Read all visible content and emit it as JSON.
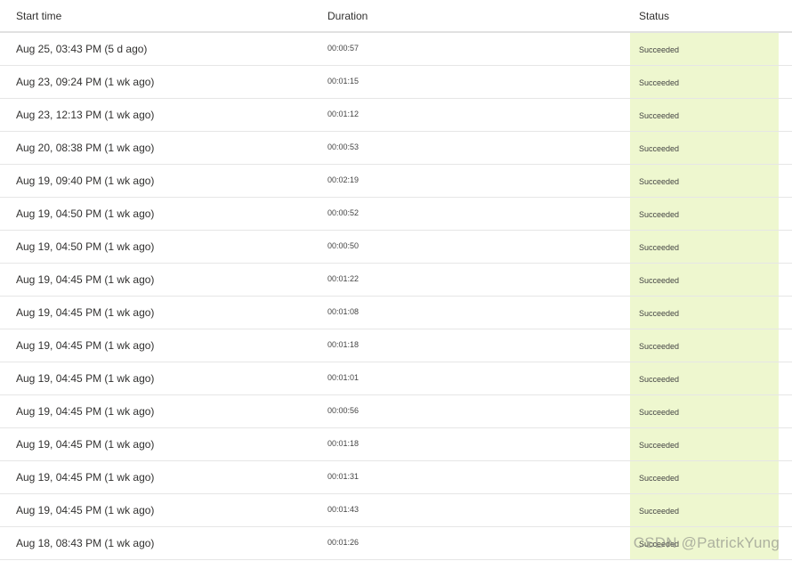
{
  "table": {
    "headers": {
      "start_time": "Start time",
      "duration": "Duration",
      "status": "Status"
    },
    "status_color": "#eef7cf",
    "rows": [
      {
        "start_time": "Aug 25, 03:43 PM (5 d ago)",
        "duration": "00:00:57",
        "status": "Succeeded"
      },
      {
        "start_time": "Aug 23, 09:24 PM (1 wk ago)",
        "duration": "00:01:15",
        "status": "Succeeded"
      },
      {
        "start_time": "Aug 23, 12:13 PM (1 wk ago)",
        "duration": "00:01:12",
        "status": "Succeeded"
      },
      {
        "start_time": "Aug 20, 08:38 PM (1 wk ago)",
        "duration": "00:00:53",
        "status": "Succeeded"
      },
      {
        "start_time": "Aug 19, 09:40 PM (1 wk ago)",
        "duration": "00:02:19",
        "status": "Succeeded"
      },
      {
        "start_time": "Aug 19, 04:50 PM (1 wk ago)",
        "duration": "00:00:52",
        "status": "Succeeded"
      },
      {
        "start_time": "Aug 19, 04:50 PM (1 wk ago)",
        "duration": "00:00:50",
        "status": "Succeeded"
      },
      {
        "start_time": "Aug 19, 04:45 PM (1 wk ago)",
        "duration": "00:01:22",
        "status": "Succeeded"
      },
      {
        "start_time": "Aug 19, 04:45 PM (1 wk ago)",
        "duration": "00:01:08",
        "status": "Succeeded"
      },
      {
        "start_time": "Aug 19, 04:45 PM (1 wk ago)",
        "duration": "00:01:18",
        "status": "Succeeded"
      },
      {
        "start_time": "Aug 19, 04:45 PM (1 wk ago)",
        "duration": "00:01:01",
        "status": "Succeeded"
      },
      {
        "start_time": "Aug 19, 04:45 PM (1 wk ago)",
        "duration": "00:00:56",
        "status": "Succeeded"
      },
      {
        "start_time": "Aug 19, 04:45 PM (1 wk ago)",
        "duration": "00:01:18",
        "status": "Succeeded"
      },
      {
        "start_time": "Aug 19, 04:45 PM (1 wk ago)",
        "duration": "00:01:31",
        "status": "Succeeded"
      },
      {
        "start_time": "Aug 19, 04:45 PM (1 wk ago)",
        "duration": "00:01:43",
        "status": "Succeeded"
      },
      {
        "start_time": "Aug 18, 08:43 PM (1 wk ago)",
        "duration": "00:01:26",
        "status": "Succeeded"
      }
    ]
  },
  "watermark": "CSDN @PatrickYung"
}
